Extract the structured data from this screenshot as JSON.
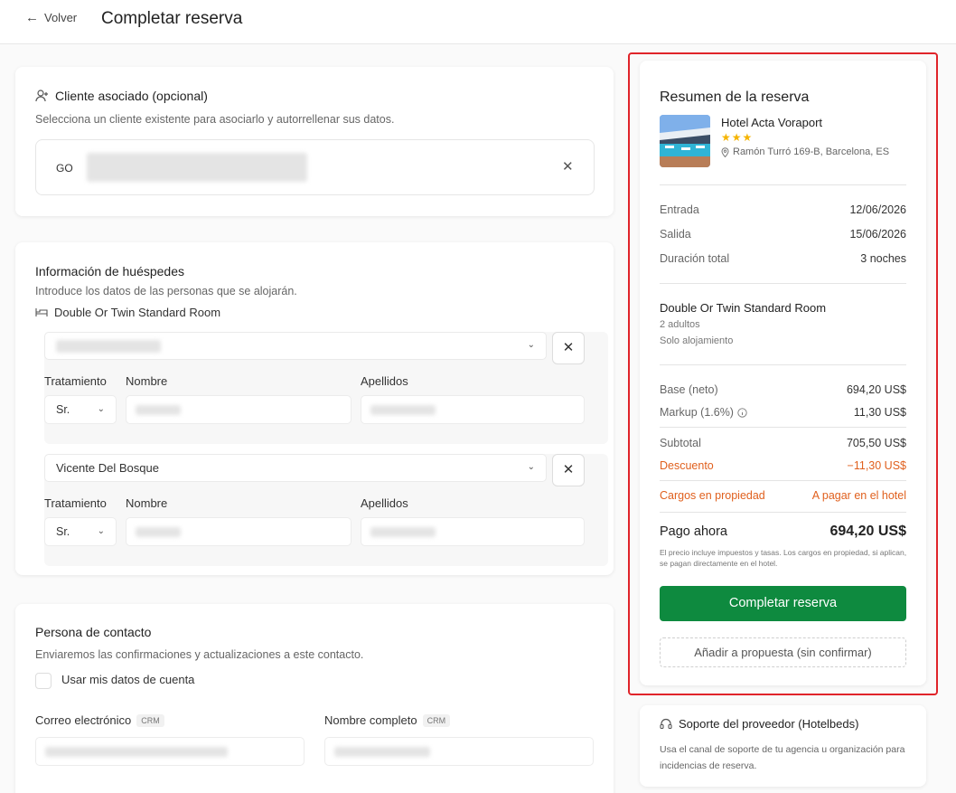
{
  "header": {
    "back_label": "Volver",
    "title": "Completar reserva"
  },
  "client": {
    "title": "Cliente asociado (opcional)",
    "subtitle": "Selecciona un cliente existente para asociarlo y autorrellenar sus datos.",
    "initials": "GO"
  },
  "guests": {
    "title": "Información de huéspedes",
    "subtitle": "Introduce los datos de las personas que se alojarán.",
    "room_name": "Double Or Twin Standard Room",
    "labels": {
      "treatment": "Tratamiento",
      "first_name": "Nombre",
      "last_name": "Apellidos"
    },
    "entries": [
      {
        "guest_select": "",
        "treatment": "Sr."
      },
      {
        "guest_select": "Vicente Del Bosque",
        "treatment": "Sr."
      }
    ]
  },
  "contact": {
    "title": "Persona de contacto",
    "subtitle": "Enviaremos las confirmaciones y actualizaciones a este contacto.",
    "use_account_label": "Usar mis datos de cuenta",
    "email_label": "Correo electrónico",
    "name_label": "Nombre completo",
    "crm_badge": "CRM"
  },
  "summary": {
    "title": "Resumen de la reserva",
    "hotel_name": "Hotel Acta Voraport",
    "stars": "★★★",
    "address": "Ramón Turró 169-B, Barcelona, ES",
    "checkin_label": "Entrada",
    "checkin": "12/06/2026",
    "checkout_label": "Salida",
    "checkout": "15/06/2026",
    "duration_label": "Duración total",
    "duration": "3 noches",
    "room_name": "Double Or Twin Standard Room",
    "occupancy": "2 adultos",
    "board": "Solo alojamiento",
    "base_label": "Base (neto)",
    "base": "694,20 US$",
    "markup_label": "Markup (1.6%)",
    "markup": "11,30 US$",
    "subtotal_label": "Subtotal",
    "subtotal": "705,50 US$",
    "discount_label": "Descuento",
    "discount": "−11,30 US$",
    "property_charges_label": "Cargos en propiedad",
    "property_charges": "A pagar en el hotel",
    "pay_now_label": "Pago ahora",
    "pay_now": "694,20 US$",
    "note": "El precio incluye impuestos y tasas. Los cargos en propiedad, si aplican, se pagan directamente en el hotel.",
    "complete_button": "Completar reserva",
    "proposal_button": "Añadir a propuesta (sin confirmar)"
  },
  "support": {
    "title": "Soporte del proveedor (Hotelbeds)",
    "text": "Usa el canal de soporte de tu agencia u organización para incidencias de reserva."
  },
  "colors": {
    "accent_green": "#0e8a3f",
    "discount_orange": "#e0601e",
    "highlight_red": "#e0242a",
    "star_yellow": "#f5b400"
  }
}
